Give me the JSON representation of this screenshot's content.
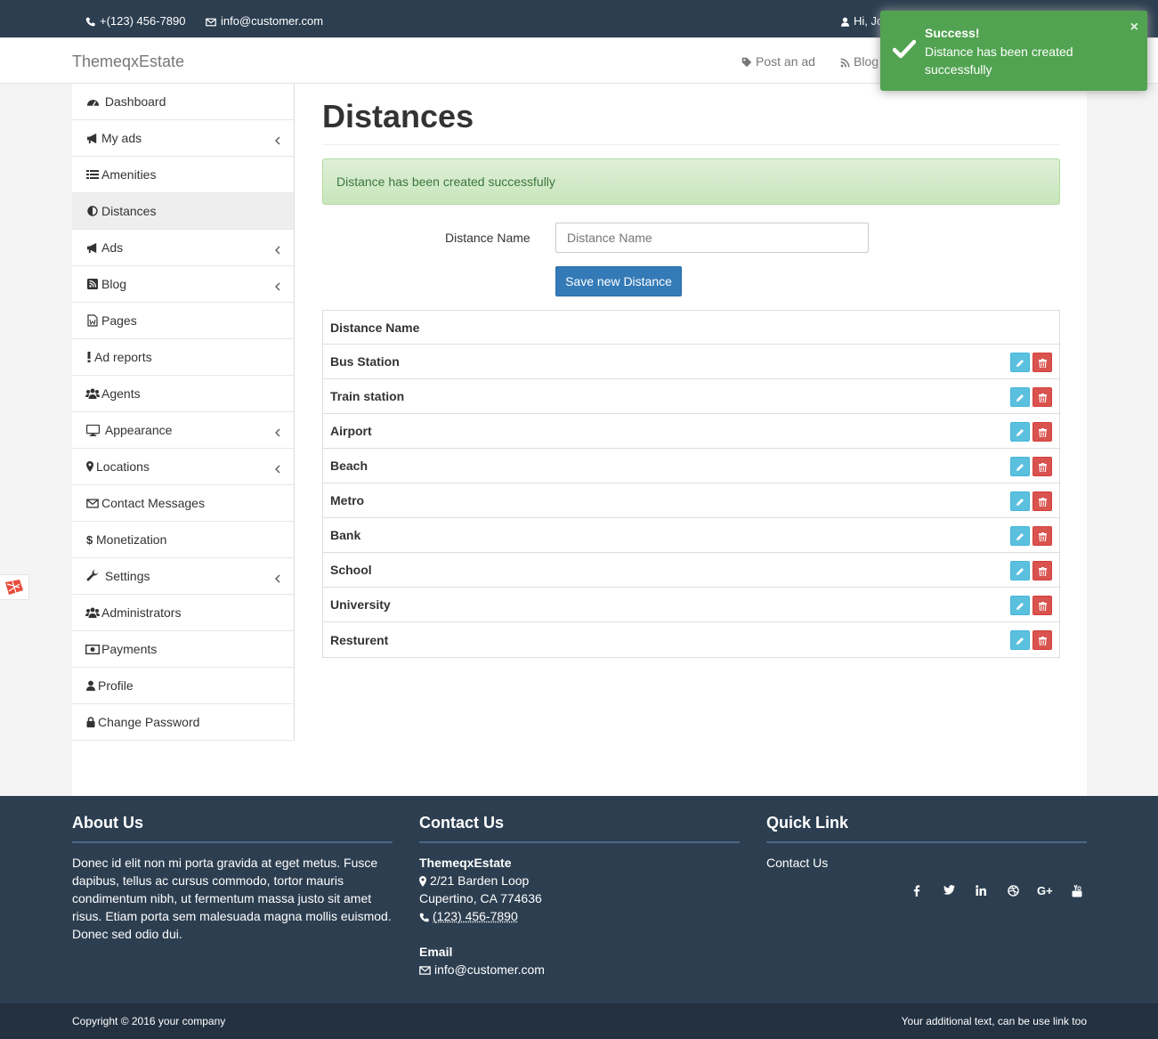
{
  "topbar": {
    "phone": "+(123) 456-7890",
    "email": "info@customer.com",
    "greeting": "Hi, Jo"
  },
  "navbar": {
    "brand": "ThemeqxEstate",
    "links": [
      {
        "label": "Post an ad",
        "icon": "tag-icon"
      },
      {
        "label": "Blog",
        "icon": "rss-icon"
      }
    ]
  },
  "sidebar": {
    "items": [
      {
        "label": "Dashboard",
        "icon": "dashboard-icon",
        "submenu": false
      },
      {
        "label": "My ads",
        "icon": "bullhorn-icon",
        "submenu": true
      },
      {
        "label": "Amenities",
        "icon": "list-icon",
        "submenu": false
      },
      {
        "label": "Distances",
        "icon": "adjust-icon",
        "submenu": false,
        "active": true
      },
      {
        "label": "Ads",
        "icon": "bullhorn-icon",
        "submenu": true
      },
      {
        "label": "Blog",
        "icon": "rss-square-icon",
        "submenu": true
      },
      {
        "label": "Pages",
        "icon": "file-word-icon",
        "submenu": false
      },
      {
        "label": "Ad reports",
        "icon": "exclamation-icon",
        "submenu": false
      },
      {
        "label": "Agents",
        "icon": "users-icon",
        "submenu": false
      },
      {
        "label": "Appearance",
        "icon": "desktop-icon",
        "submenu": true
      },
      {
        "label": "Locations",
        "icon": "map-marker-icon",
        "submenu": true
      },
      {
        "label": "Contact Messages",
        "icon": "envelope-icon",
        "submenu": false
      },
      {
        "label": "Monetization",
        "icon": "dollar-icon",
        "submenu": false
      },
      {
        "label": "Settings",
        "icon": "wrench-icon",
        "submenu": true
      },
      {
        "label": "Administrators",
        "icon": "users-icon",
        "submenu": false
      },
      {
        "label": "Payments",
        "icon": "money-icon",
        "submenu": false
      },
      {
        "label": "Profile",
        "icon": "user-icon",
        "submenu": false
      },
      {
        "label": "Change Password",
        "icon": "lock-icon",
        "submenu": false
      }
    ]
  },
  "main": {
    "title": "Distances",
    "alert": "Distance has been created successfully",
    "form": {
      "label": "Distance Name",
      "placeholder": "Distance Name",
      "save_label": "Save new Distance"
    },
    "table": {
      "header": "Distance Name",
      "rows": [
        "Bus Station",
        "Train station",
        "Airport",
        "Beach",
        "Metro",
        "Bank",
        "School",
        "University",
        "Resturent"
      ]
    }
  },
  "toast": {
    "title": "Success!",
    "message": "Distance has been created successfully",
    "close": "×"
  },
  "footer": {
    "about": {
      "title": "About Us",
      "text": "Donec id elit non mi porta gravida at eget metus. Fusce dapibus, tellus ac cursus commodo, tortor mauris condimentum nibh, ut fermentum massa justo sit amet risus. Etiam porta sem malesuada magna mollis euismod. Donec sed odio dui."
    },
    "contact": {
      "title": "Contact Us",
      "company": "ThemeqxEstate",
      "address1": "2/21 Barden Loop",
      "address2": "Cupertino, CA 774636",
      "phone": "(123) 456-7890",
      "email_label": "Email",
      "email": "info@customer.com"
    },
    "quick": {
      "title": "Quick Link",
      "link": "Contact Us"
    },
    "social": [
      "facebook-icon",
      "twitter-icon",
      "linkedin-icon",
      "dribbble-icon",
      "google-plus-icon",
      "youtube-icon"
    ],
    "copyright": "Copyright © 2016 your company",
    "additional": "Your additional text, can be use link too"
  },
  "colors": {
    "dark": "#2c3e50",
    "primary": "#337ab7",
    "success": "#51a351",
    "info": "#5bc0de",
    "danger": "#d9534f"
  }
}
